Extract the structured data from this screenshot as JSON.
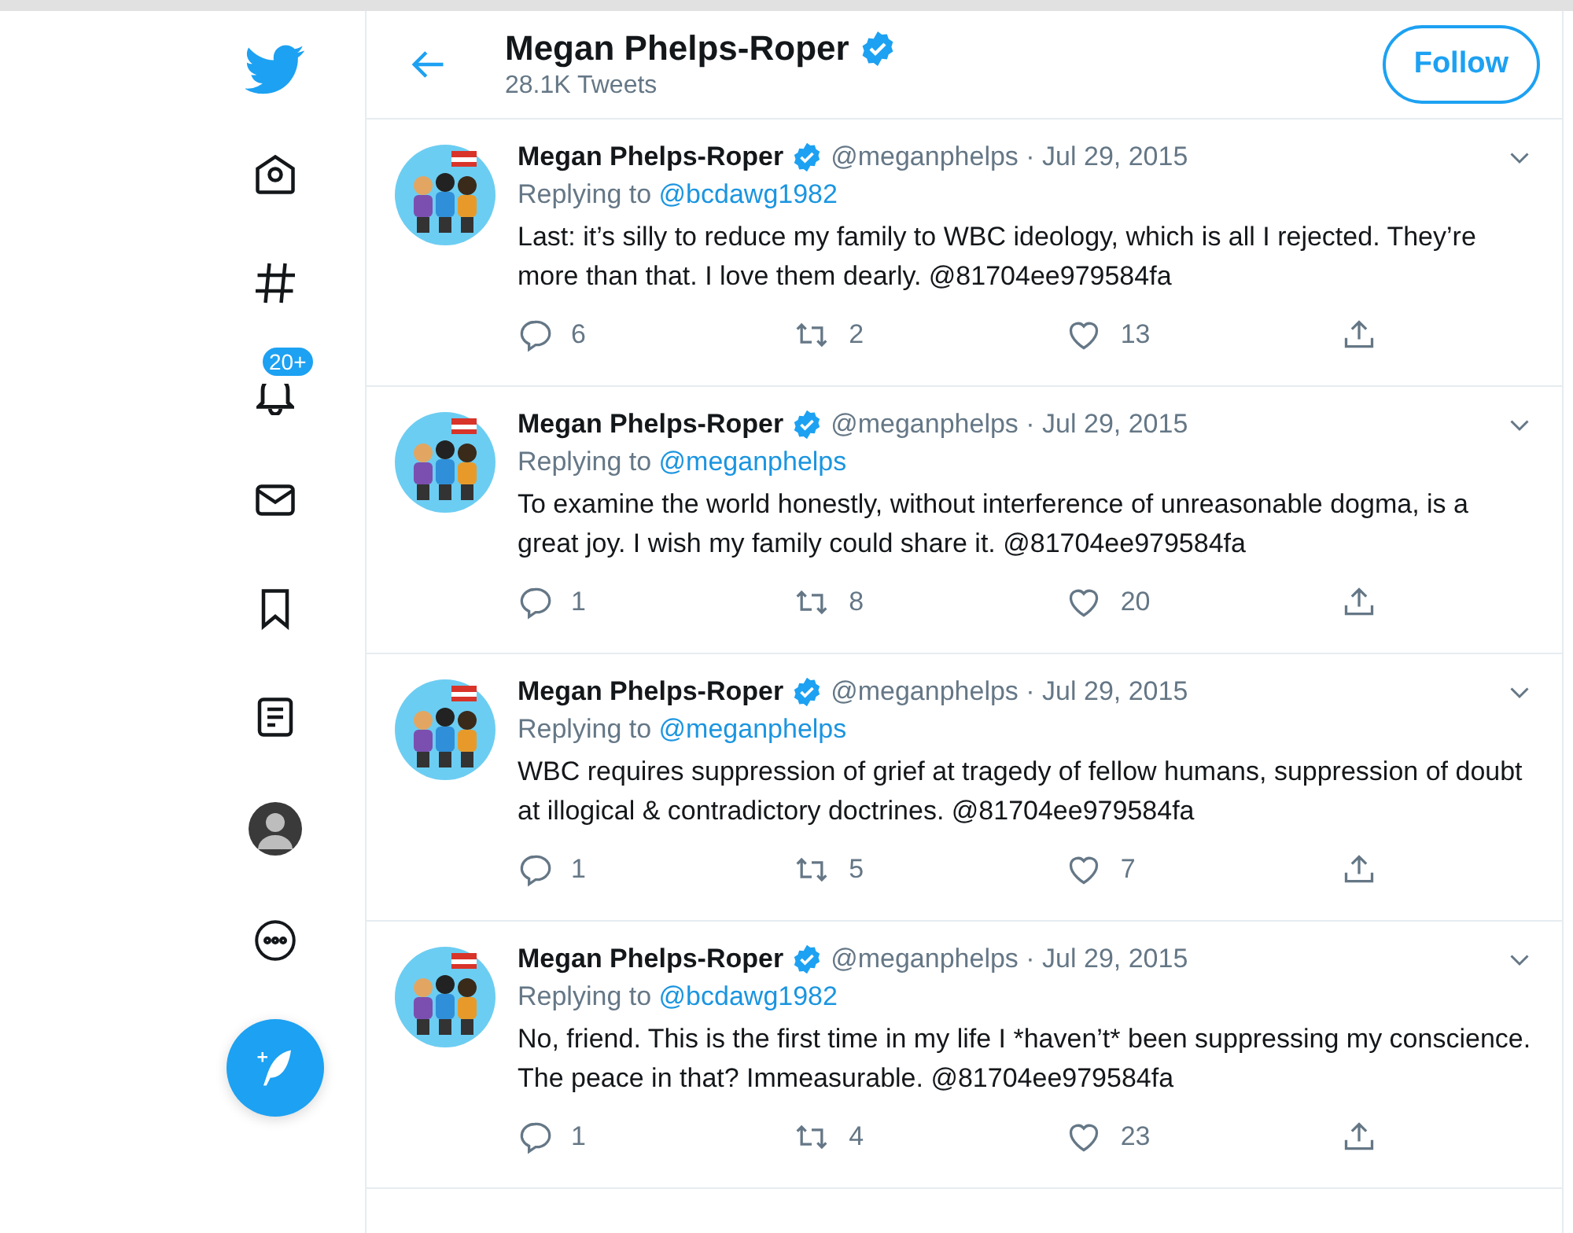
{
  "sidebar": {
    "notification_badge": "20+"
  },
  "header": {
    "title": "Megan Phelps-Roper",
    "verified": true,
    "subtitle": "28.1K Tweets",
    "follow_button": "Follow"
  },
  "tweets": [
    {
      "name": "Megan Phelps-Roper",
      "verified": true,
      "meta": "@meganphelps · Jul 29, 2015",
      "reply_label": "Replying to",
      "reply_to": "@bcdawg1982",
      "text": "Last: it’s silly to reduce my family to WBC ideology, which is all I rejected. They’re more than that. I love them dearly. @81704ee979584fa",
      "replies": "6",
      "retweets": "2",
      "likes": "13"
    },
    {
      "name": "Megan Phelps-Roper",
      "verified": true,
      "meta": "@meganphelps · Jul 29, 2015",
      "reply_label": "Replying to",
      "reply_to": "@meganphelps",
      "text": "To examine the world honestly, without interference of unreasonable dogma, is a great joy. I wish my family could share it. @81704ee979584fa",
      "replies": "1",
      "retweets": "8",
      "likes": "20"
    },
    {
      "name": "Megan Phelps-Roper",
      "verified": true,
      "meta": "@meganphelps · Jul 29, 2015",
      "reply_label": "Replying to",
      "reply_to": "@meganphelps",
      "text": "WBC requires suppression of grief at tragedy of fellow humans, suppression of doubt at illogical & contradictory doctrines. @81704ee979584fa",
      "replies": "1",
      "retweets": "5",
      "likes": "7"
    },
    {
      "name": "Megan Phelps-Roper",
      "verified": true,
      "meta": "@meganphelps · Jul 29, 2015",
      "reply_label": "Replying to",
      "reply_to": "@bcdawg1982",
      "text": "No, friend. This is the first time in my life I *haven’t* been suppressing my conscience. The peace in that? Immeasurable. @81704ee979584fa",
      "replies": "1",
      "retweets": "4",
      "likes": "23"
    }
  ]
}
